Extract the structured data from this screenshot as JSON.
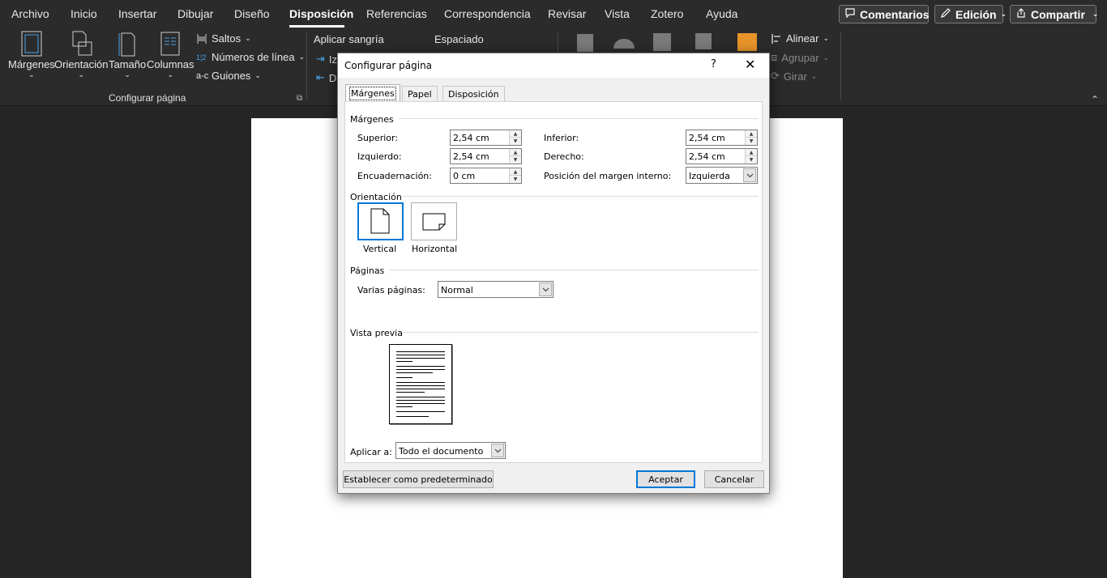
{
  "menu": {
    "items": [
      "Archivo",
      "Inicio",
      "Insertar",
      "Dibujar",
      "Diseño",
      "Disposición",
      "Referencias",
      "Correspondencia",
      "Revisar",
      "Vista",
      "Zotero",
      "Ayuda"
    ],
    "active": "Disposición",
    "comments": "Comentarios",
    "editing": "Edición",
    "share": "Compartir"
  },
  "ribbon": {
    "margins": "Márgenes",
    "orientation": "Orientación",
    "size": "Tamaño",
    "columns": "Columnas",
    "breaks": "Saltos",
    "line_numbers": "Números de línea",
    "hyphenation": "Guiones",
    "page_setup_group": "Configurar página",
    "indent": "Aplicar sangría",
    "spacing": "Espaciado",
    "indent_left_short": "Iz",
    "indent_right_short": "D",
    "align": "Alinear",
    "group": "Agrupar",
    "rotate": "Girar"
  },
  "dialog": {
    "title": "Configurar página",
    "help": "?",
    "close": "✕",
    "tabs": [
      "Márgenes",
      "Papel",
      "Disposición"
    ],
    "active_tab": "Márgenes",
    "margins_section": "Márgenes",
    "top_label": "Superior:",
    "top_value": "2,54 cm",
    "bottom_label": "Inferior:",
    "bottom_value": "2,54 cm",
    "left_label": "Izquierdo:",
    "left_value": "2,54 cm",
    "right_label": "Derecho:",
    "right_value": "2,54 cm",
    "gutter_label": "Encuadernación:",
    "gutter_value": "0 cm",
    "gutter_pos_label": "Posición del margen interno:",
    "gutter_pos_value": "Izquierda",
    "orientation_section": "Orientación",
    "portrait": "Vertical",
    "landscape": "Horizontal",
    "pages_section": "Páginas",
    "multiple_pages_label": "Varias páginas:",
    "multiple_pages_value": "Normal",
    "preview_section": "Vista previa",
    "apply_to_label": "Aplicar a:",
    "apply_to_value": "Todo el documento",
    "set_default": "Establecer como predeterminado",
    "ok": "Aceptar",
    "cancel": "Cancelar"
  },
  "colors": {
    "accent": "#0078d7",
    "dark_bg": "#262626",
    "ribbon_bg": "#2b2b2b"
  }
}
